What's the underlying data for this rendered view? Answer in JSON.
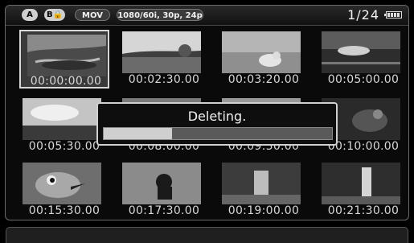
{
  "status_bar": {
    "badges": [
      {
        "label": "A"
      },
      {
        "label": "B"
      },
      {
        "label": "MOV"
      },
      {
        "label": "1080/60i, 30p, 24p"
      }
    ],
    "counter": "1/24"
  },
  "thumbnails": [
    {
      "time": "00:00:00.00",
      "selected": true
    },
    {
      "time": "00:02:30.00"
    },
    {
      "time": "00:03:20.00"
    },
    {
      "time": "00:05:00.00"
    },
    {
      "time": "00:05:30.00"
    },
    {
      "time": "00:08:00.00"
    },
    {
      "time": "00:09:30.00"
    },
    {
      "time": "00:10:00.00"
    },
    {
      "time": "00:15:30.00"
    },
    {
      "time": "00:17:30.00"
    },
    {
      "time": "00:19:00.00"
    },
    {
      "time": "00:21:30.00"
    }
  ],
  "dialog": {
    "message": "Deleting.",
    "progress": 0.3
  }
}
